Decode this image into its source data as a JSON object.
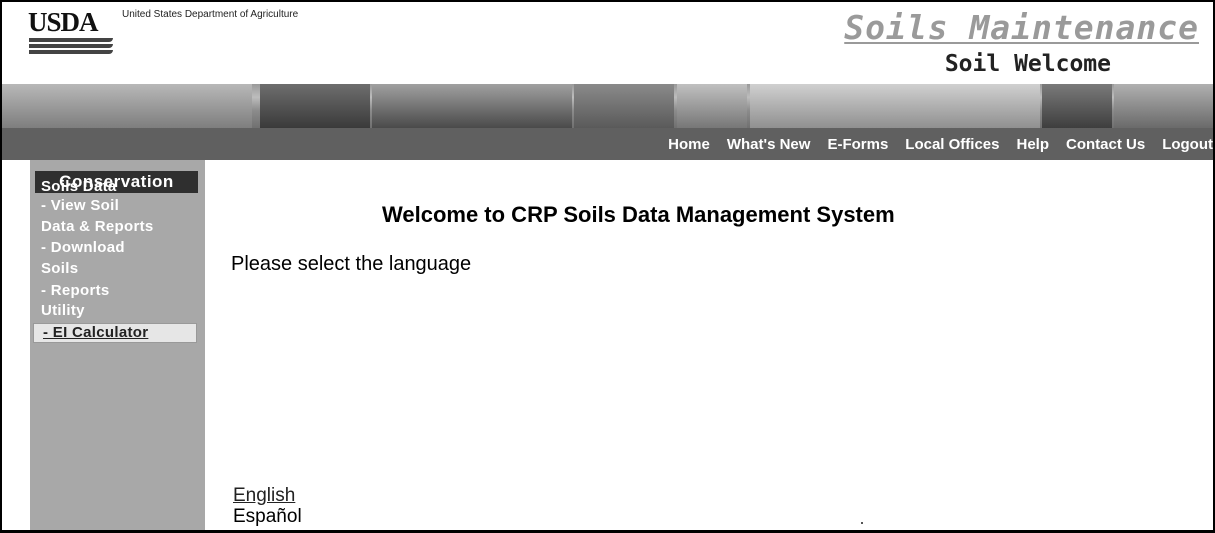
{
  "header": {
    "logo_text": "USDA",
    "department": "United States Department of Agriculture",
    "app_title": "Soils Maintenance",
    "page_subtitle": "Soil Welcome"
  },
  "nav": {
    "items": [
      {
        "label": "Home"
      },
      {
        "label": "What's New"
      },
      {
        "label": "E-Forms"
      },
      {
        "label": "Local Offices"
      },
      {
        "label": "Help"
      },
      {
        "label": "Contact Us"
      },
      {
        "label": "Logout"
      }
    ]
  },
  "sidebar": {
    "title": "Conservation",
    "items": [
      {
        "label": "Soils Data"
      },
      {
        "label": " - View Soil"
      },
      {
        "label": "Data & Reports"
      },
      {
        "label": " - Download"
      },
      {
        "label": "Soils"
      },
      {
        "label": " - Reports"
      },
      {
        "label": "Utility"
      },
      {
        "label": " - EI Calculator"
      }
    ]
  },
  "main": {
    "heading": "Welcome to CRP Soils Data Management System",
    "prompt": "Please select the language",
    "languages": [
      {
        "label": "English"
      },
      {
        "label": "Español"
      }
    ]
  },
  "colors": {
    "nav_bg": "#606060",
    "sidebar_bg": "#a8a8a8",
    "sidebar_title_bg": "#2f2f2f",
    "title_gray": "#9a9a9a"
  }
}
